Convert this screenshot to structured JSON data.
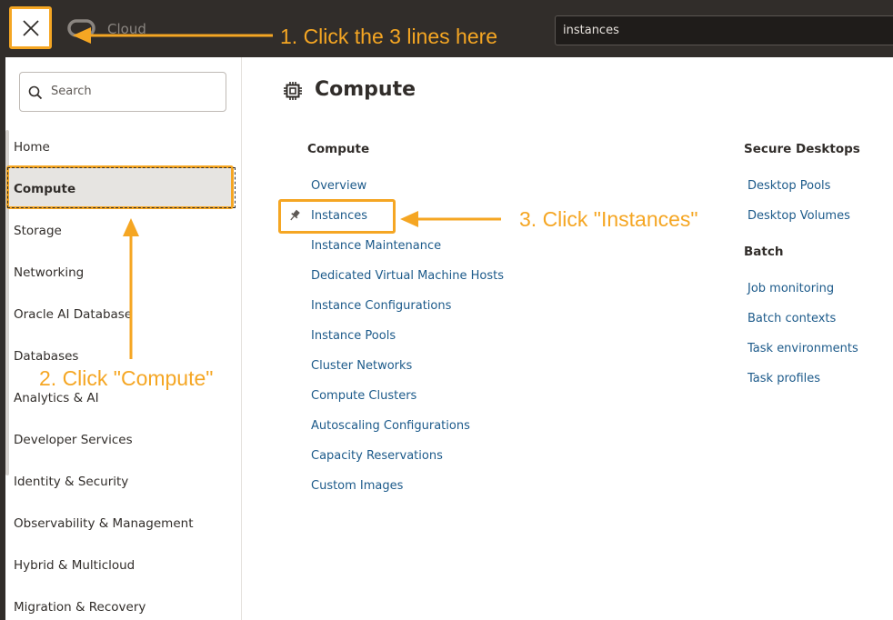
{
  "topbar": {
    "brand": "Cloud",
    "search_value": "instances"
  },
  "sidebar": {
    "search_placeholder": "Search",
    "items": [
      {
        "label": "Home"
      },
      {
        "label": "Compute"
      },
      {
        "label": "Storage"
      },
      {
        "label": "Networking"
      },
      {
        "label": "Oracle AI Database"
      },
      {
        "label": "Databases"
      },
      {
        "label": "Analytics & AI"
      },
      {
        "label": "Developer Services"
      },
      {
        "label": "Identity & Security"
      },
      {
        "label": "Observability & Management"
      },
      {
        "label": "Hybrid & Multicloud"
      },
      {
        "label": "Migration & Recovery"
      }
    ]
  },
  "main": {
    "title": "Compute",
    "compute_heading": "Compute",
    "compute_links": [
      "Overview",
      "Instances",
      "Instance Maintenance",
      "Dedicated Virtual Machine Hosts",
      "Instance Configurations",
      "Instance Pools",
      "Cluster Networks",
      "Compute Clusters",
      "Autoscaling Configurations",
      "Capacity Reservations",
      "Custom Images"
    ],
    "desktops_heading": "Secure Desktops",
    "desktops_links": [
      "Desktop Pools",
      "Desktop Volumes"
    ],
    "batch_heading": "Batch",
    "batch_links": [
      "Job monitoring",
      "Batch contexts",
      "Task environments",
      "Task profiles"
    ]
  },
  "annotations": {
    "step1": "1. Click the 3 lines here",
    "step2": "2. Click \"Compute\"",
    "step3": "3. Click \"Instances\""
  },
  "colors": {
    "annotation": "#f5a623",
    "topbar": "#312d2a",
    "link": "#1c5a8a"
  }
}
